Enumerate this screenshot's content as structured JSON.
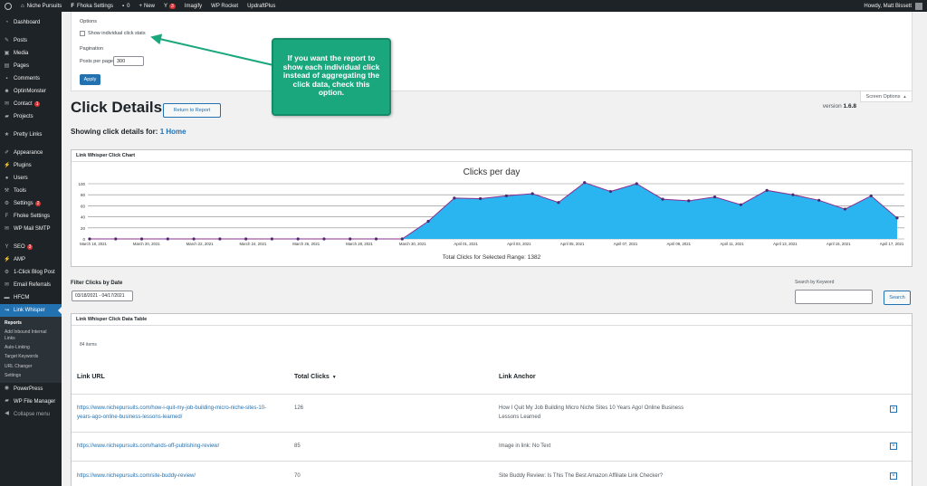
{
  "adminbar": {
    "site_name": "Niche Pursuits",
    "fhoka_settings": "Fhoka Settings",
    "comments_count": "0",
    "new_label": "New",
    "yoast_count": "3",
    "imagify": "Imagify",
    "wp_rocket": "WP Rocket",
    "updraftplus": "UpdraftPlus",
    "howdy": "Howdy, Matt Bissett"
  },
  "sidebar": {
    "items": [
      {
        "label": "Dashboard",
        "icon": "dashboard-icon"
      },
      {
        "label": "Posts",
        "icon": "pin-icon"
      },
      {
        "label": "Media",
        "icon": "media-icon"
      },
      {
        "label": "Pages",
        "icon": "page-icon"
      },
      {
        "label": "Comments",
        "icon": "comment-icon"
      },
      {
        "label": "OptinMonster",
        "icon": "optinmonster-icon"
      },
      {
        "label": "Contact",
        "icon": "mail-icon",
        "count": "1"
      },
      {
        "label": "Projects",
        "icon": "folder-icon"
      },
      {
        "label": "Pretty Links",
        "icon": "link-icon"
      },
      {
        "label": "Appearance",
        "icon": "brush-icon"
      },
      {
        "label": "Plugins",
        "icon": "plugin-icon"
      },
      {
        "label": "Users",
        "icon": "user-icon"
      },
      {
        "label": "Tools",
        "icon": "wrench-icon"
      },
      {
        "label": "Settings",
        "icon": "settings-icon",
        "count": "2"
      },
      {
        "label": "Fhoke Settings",
        "icon": "f-icon"
      },
      {
        "label": "WP Mail SMTP",
        "icon": "envelope-icon"
      },
      {
        "label": "SEO",
        "icon": "yoast-icon",
        "count": "3"
      },
      {
        "label": "AMP",
        "icon": "amp-icon"
      },
      {
        "label": "1-Click Blog Post",
        "icon": "gear-icon"
      },
      {
        "label": "Email Referrals",
        "icon": "mail-icon"
      },
      {
        "label": "HFCM",
        "icon": "code-icon"
      },
      {
        "label": "Link Whisper",
        "icon": "link-whisper-icon"
      }
    ],
    "submenu": [
      "Reports",
      "Add Inbound Internal Links",
      "Auto-Linking",
      "Target Keywords",
      "URL Changer",
      "Settings"
    ],
    "after": [
      {
        "label": "PowerPress",
        "icon": "podcast-icon"
      },
      {
        "label": "WP File Manager",
        "icon": "file-icon"
      },
      {
        "label": "Collapse menu",
        "icon": "collapse-icon"
      }
    ]
  },
  "options": {
    "heading": "Options",
    "show_individual": "Show individual click stats",
    "pagination_heading": "Pagination",
    "posts_per_page_label": "Posts per page",
    "posts_per_page_value": "300",
    "apply": "Apply",
    "screen_options": "Screen Options"
  },
  "callout": {
    "text": "If you want the report to show each individual click instead of aggregating the click data, check this option."
  },
  "header": {
    "title": "Click Details",
    "return_button": "Return to Report",
    "version_label": "version",
    "version_number": "1.6.8",
    "showing_prefix": "Showing click details for:",
    "showing_link": "1 Home"
  },
  "chart_panel": {
    "heading": "Link Whisper Click Chart",
    "total_label": "Total Clicks for Selected Range:",
    "total_value": "1382"
  },
  "chart_data": {
    "type": "area",
    "title": "Clicks per day",
    "ylim": [
      0,
      100
    ],
    "yticks": [
      "0",
      "20",
      "40",
      "60",
      "80",
      "100"
    ],
    "xticks": [
      "March 18, 2021",
      "March 20, 2021",
      "March 22, 2021",
      "March 24, 2021",
      "March 26, 2021",
      "March 28, 2021",
      "March 30, 2021",
      "April 01, 2021",
      "April 03, 2021",
      "April 05, 2021",
      "April 07, 2021",
      "April 09, 2021",
      "April 11, 2021",
      "April 13, 2021",
      "April 15, 2021",
      "April 17, 2021"
    ],
    "x": [
      "2021-03-18",
      "2021-03-19",
      "2021-03-20",
      "2021-03-21",
      "2021-03-22",
      "2021-03-23",
      "2021-03-24",
      "2021-03-25",
      "2021-03-26",
      "2021-03-27",
      "2021-03-28",
      "2021-03-29",
      "2021-03-30",
      "2021-03-31",
      "2021-04-01",
      "2021-04-02",
      "2021-04-03",
      "2021-04-04",
      "2021-04-05",
      "2021-04-06",
      "2021-04-07",
      "2021-04-08",
      "2021-04-09",
      "2021-04-10",
      "2021-04-11",
      "2021-04-12",
      "2021-04-13",
      "2021-04-14",
      "2021-04-15",
      "2021-04-16",
      "2021-04-17"
    ],
    "values": [
      0,
      0,
      0,
      0,
      0,
      0,
      0,
      0,
      0,
      0,
      0,
      0,
      0,
      32,
      74,
      73,
      78,
      82,
      66,
      102,
      86,
      100,
      72,
      69,
      76,
      62,
      88,
      80,
      70,
      54,
      78,
      38
    ],
    "grid": true,
    "legend": "none",
    "fill_color": "#2bb5f0",
    "line_color": "#8e2d91"
  },
  "filter": {
    "label": "Filter Clicks by Date",
    "date_range": "03/18/2021 - 04/17/2021",
    "search_label": "Search by Keyword",
    "search_button": "Search"
  },
  "table": {
    "heading": "Link Whisper Click Data Table",
    "items_count": "84 items",
    "columns": {
      "url": "Link URL",
      "clicks": "Total Clicks",
      "anchor": "Link Anchor"
    },
    "rows": [
      {
        "url": "https://www.nichepursuits.com/how-i-quit-my-job-building-micro-niche-sites-10-years-ago-online-business-lessons-learned/",
        "clicks": "126",
        "anchor": "How I Quit My Job Building Micro Niche Sites 10 Years Ago! Online Business Lessons Learned"
      },
      {
        "url": "https://www.nichepursuits.com/hands-off-publishing-review/",
        "clicks": "85",
        "anchor": "Image in link: No Text"
      },
      {
        "url": "https://www.nichepursuits.com/site-buddy-review/",
        "clicks": "70",
        "anchor": "Site Buddy Review: Is This The Best Amazon Affiliate Link Checker?"
      }
    ]
  }
}
